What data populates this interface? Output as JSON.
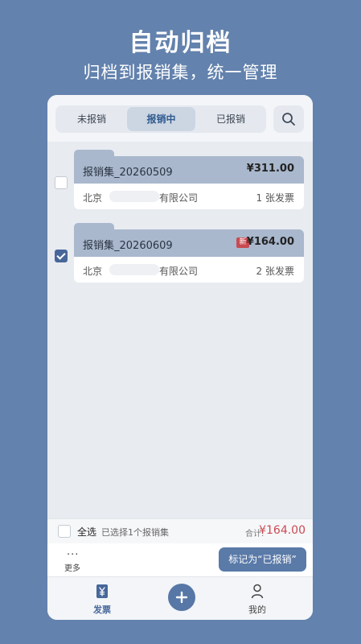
{
  "hero": {
    "title": "自动归档",
    "subtitle": "归档到报销集，统一管理"
  },
  "tabs": [
    {
      "label": "未报销",
      "active": false
    },
    {
      "label": "报销中",
      "active": true
    },
    {
      "label": "已报销",
      "active": false
    }
  ],
  "search": {
    "icon": "search-icon"
  },
  "reimbursements": [
    {
      "name": "报销集_20260509",
      "amount": "¥311.00",
      "is_new": false,
      "checked": false,
      "company_prefix": "北京",
      "company_suffix": "有限公司",
      "invoice_count": "1 张发票"
    },
    {
      "name": "报销集_20260609",
      "amount": "¥164.00",
      "is_new": true,
      "new_label": "新",
      "checked": true,
      "company_prefix": "北京",
      "company_suffix": "有限公司",
      "invoice_count": "2 张发票"
    }
  ],
  "footer": {
    "select_all": "全选",
    "selected_info": "已选择1个报销集",
    "total_label": "合计:",
    "total_amount": "¥164.00",
    "more_label": "更多",
    "mark_button": "标记为“已报销”"
  },
  "nav": {
    "invoices": {
      "label": "发票",
      "icon": "yen-document-icon"
    },
    "add": {
      "icon": "plus-icon"
    },
    "mine": {
      "label": "我的",
      "icon": "person-icon"
    }
  },
  "colors": {
    "background": "#6382ad",
    "accent": "#5a7aa8",
    "folder": "#a9b8cd",
    "price": "#c94a52",
    "badge": "#c94a52"
  }
}
